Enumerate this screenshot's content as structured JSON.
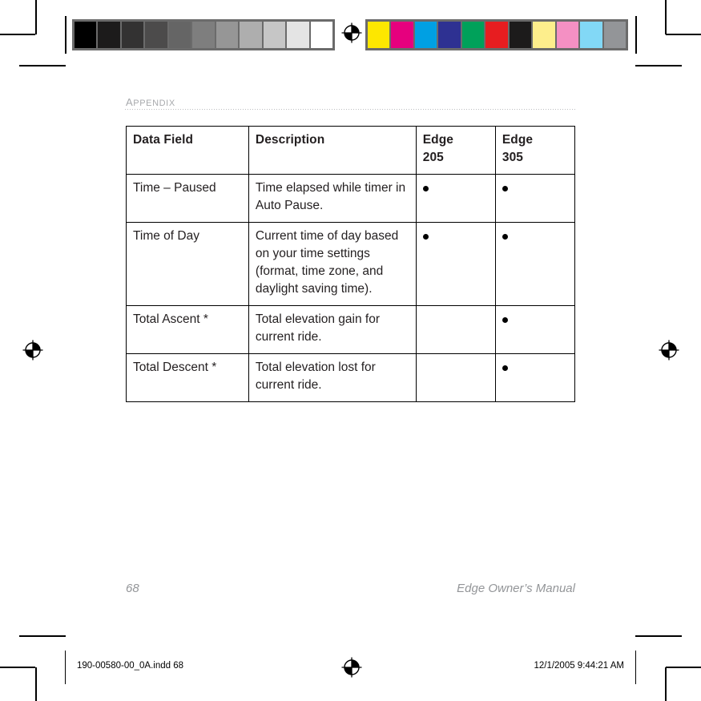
{
  "page": {
    "section_label": "Appendix",
    "folio": "68",
    "manual_title": "Edge Owner’s Manual"
  },
  "table": {
    "headers": {
      "field": "Data Field",
      "description": "Description",
      "edge_205": "Edge\n205",
      "edge_305": "Edge\n305"
    },
    "rows": [
      {
        "field": "Time – Paused",
        "description": "Time elapsed while timer in Auto Pause.",
        "edge_205": "●",
        "edge_305": "●"
      },
      {
        "field": "Time of Day",
        "description": "Current time of day based on your time settings (format, time zone, and daylight saving time).",
        "edge_205": "●",
        "edge_305": "●"
      },
      {
        "field": "Total Ascent *",
        "description": "Total elevation gain for current ride.",
        "edge_205": "",
        "edge_305": "●"
      },
      {
        "field": "Total Descent *",
        "description": "Total elevation lost for current ride.",
        "edge_205": "",
        "edge_305": "●"
      }
    ]
  },
  "prepress": {
    "filename_slug": "190-00580-00_0A.indd   68",
    "timestamp_slug": "12/1/2005   9:44:21 AM",
    "grayscale_bar": [
      "#000000",
      "#1c1b1b",
      "#333232",
      "#4c4b4b",
      "#656565",
      "#7e7e7e",
      "#969696",
      "#aeaeae",
      "#c6c6c6",
      "#e4e4e4",
      "#ffffff"
    ],
    "color_bar": [
      "#fde700",
      "#e6007e",
      "#00a0e3",
      "#2e3192",
      "#00a15a",
      "#e71d20",
      "#1c1b1b",
      "#fdee8c",
      "#f490c3",
      "#82d8f6",
      "#939598"
    ],
    "registration_mark_name": "registration-target"
  }
}
